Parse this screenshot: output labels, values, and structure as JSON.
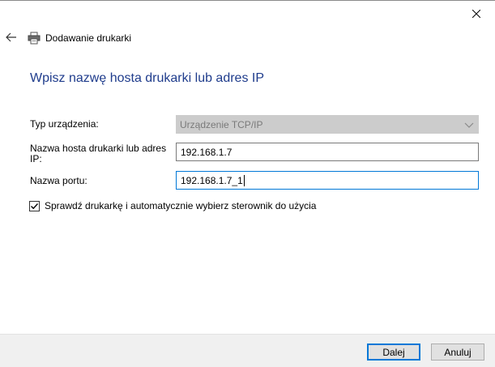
{
  "window": {
    "title": "Dodawanie drukarki"
  },
  "page": {
    "heading": "Wpisz nazwę hosta drukarki lub adres IP"
  },
  "form": {
    "device_type_label": "Typ urządzenia:",
    "device_type_value": "Urządzenie TCP/IP",
    "hostname_label": "Nazwa hosta drukarki lub adres IP:",
    "hostname_value": "192.168.1.7",
    "port_label": "Nazwa portu:",
    "port_value": "192.168.1.7_1",
    "checkbox_label": "Sprawdź drukarkę i automatycznie wybierz sterownik do użycia",
    "checkbox_checked": true
  },
  "footer": {
    "next_label": "Dalej",
    "cancel_label": "Anuluj"
  },
  "icons": {
    "close": "close-icon",
    "back": "back-arrow-icon",
    "printer": "printer-icon",
    "chevron": "chevron-down-icon",
    "check": "checkmark-icon"
  },
  "colors": {
    "heading": "#1f3c8c",
    "focus_border": "#0078d7",
    "disabled_bg": "#cccccc"
  }
}
